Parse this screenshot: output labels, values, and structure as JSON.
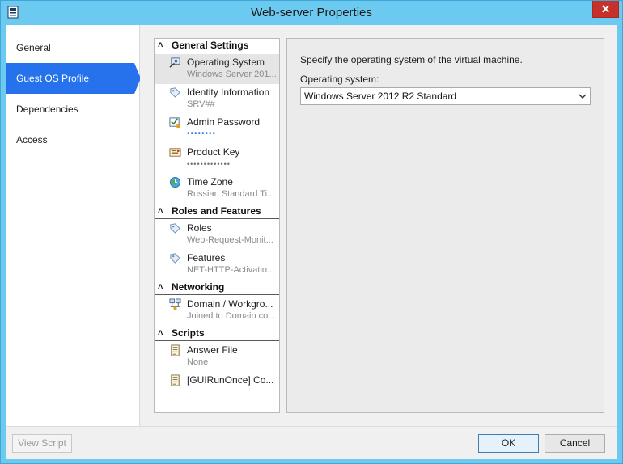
{
  "window": {
    "title": "Web-server Properties",
    "close_glyph": "✕"
  },
  "nav": {
    "items": [
      {
        "label": "General",
        "active": false
      },
      {
        "label": "Guest OS Profile",
        "active": true
      },
      {
        "label": "Dependencies",
        "active": false
      },
      {
        "label": "Access",
        "active": false
      }
    ]
  },
  "settings": {
    "groups": [
      {
        "header": "General Settings",
        "items": [
          {
            "label": "Operating System",
            "value": "Windows Server 201...",
            "icon": "os-icon",
            "selected": true
          },
          {
            "label": "Identity Information",
            "value": "SRV##",
            "icon": "tag-icon"
          },
          {
            "label": "Admin Password",
            "value": "••••••••",
            "icon": "password-icon"
          },
          {
            "label": "Product Key",
            "value": "•••••••••••••",
            "icon": "key-icon"
          },
          {
            "label": "Time Zone",
            "value": "Russian Standard Ti...",
            "icon": "globe-icon"
          }
        ]
      },
      {
        "header": "Roles and Features",
        "items": [
          {
            "label": "Roles",
            "value": "Web-Request-Monit...",
            "icon": "tag-icon"
          },
          {
            "label": "Features",
            "value": "NET-HTTP-Activatio...",
            "icon": "tag-icon"
          }
        ]
      },
      {
        "header": "Networking",
        "items": [
          {
            "label": "Domain / Workgro...",
            "value": "Joined to Domain co...",
            "icon": "network-icon"
          }
        ]
      },
      {
        "header": "Scripts",
        "items": [
          {
            "label": "Answer File",
            "value": "None",
            "icon": "script-icon"
          },
          {
            "label": "[GUIRunOnce] Co...",
            "value": "",
            "icon": "script-icon"
          }
        ]
      }
    ]
  },
  "detail": {
    "description": "Specify the operating system of the virtual machine.",
    "os_label": "Operating system:",
    "os_value": "Windows Server 2012 R2 Standard"
  },
  "footer": {
    "view_script": "View Script",
    "ok": "OK",
    "cancel": "Cancel"
  },
  "colors": {
    "titlebar": "#6cc9ef",
    "accent": "#2672ec",
    "close": "#c7312b"
  }
}
